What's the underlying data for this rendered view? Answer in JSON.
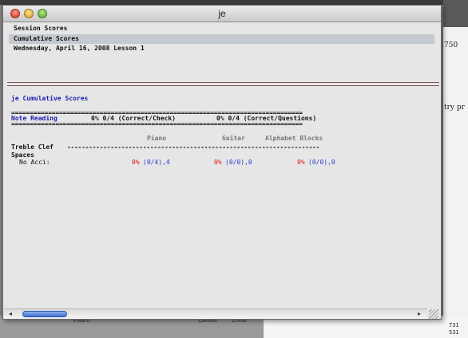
{
  "window": {
    "title": "je"
  },
  "list": [
    {
      "label": "Session Scores",
      "selected": false
    },
    {
      "label": "Cumulative Scores",
      "selected": true
    },
    {
      "label": "Wednesday, April 16, 2008 Lesson 1",
      "selected": false
    }
  ],
  "report": {
    "heading": "je Cumulative Scores",
    "rule": "===============================================================================",
    "category": "Note Reading",
    "check_stat": "0% 0/4 (Correct/Check)",
    "questions_stat": "0% 0/4 (Correct/Questions)",
    "columns": [
      "Piano",
      "Guitar",
      "Alphabet Blocks"
    ],
    "section": "Treble Clef",
    "section_rule": "----------------------------------------------------------------------",
    "subsection": "Spaces",
    "row": {
      "label": "No Acci:",
      "cells": [
        {
          "pct": "0%",
          "detail": "(0/4),4"
        },
        {
          "pct": "0%",
          "detail": "(0/0),0"
        },
        {
          "pct": "0%",
          "detail": "(0/0),0"
        }
      ]
    }
  },
  "background": {
    "right_text_1": "750",
    "right_text_2": "try pr",
    "coord_1": "731",
    "coord_2": "531",
    "tab_1": "Flasht",
    "tab_2": "Cancel",
    "tab_3": "Chrdl"
  },
  "colors": {
    "selection": "#c4c8cf",
    "heading_blue": "#1b1bb4",
    "pct_red": "#dd1111",
    "detail_blue": "#2b3bd0"
  }
}
